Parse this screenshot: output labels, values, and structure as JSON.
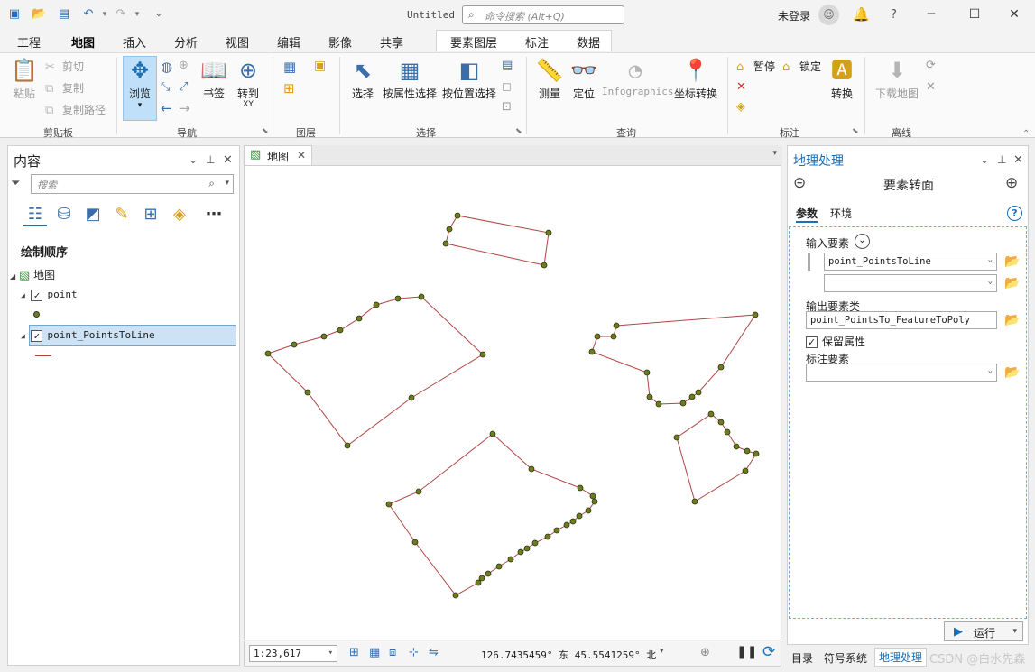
{
  "title_bar": {
    "doc_title": "Untitled",
    "search_placeholder": "命令搜索 (Alt+Q)",
    "signin_label": "未登录",
    "help_label": "?"
  },
  "ribbon_tabs": [
    "工程",
    "地图",
    "插入",
    "分析",
    "视图",
    "编辑",
    "影像",
    "共享"
  ],
  "ribbon_active_tab": "地图",
  "context_tabs": [
    "要素图层",
    "标注",
    "数据"
  ],
  "ribbon": {
    "clipboard": {
      "paste": "粘贴",
      "cut": "剪切",
      "copy": "复制",
      "copy_path": "复制路径",
      "label": "剪贴板"
    },
    "navigate": {
      "explore": "浏览",
      "bookmarks": "书签",
      "goto": "转到",
      "goto_sub": "XY",
      "label": "导航"
    },
    "layer": {
      "label": "图层"
    },
    "selection": {
      "select": "选择",
      "by_attr": "按属性选择",
      "by_loc": "按位置选择",
      "label": "选择"
    },
    "inquiry": {
      "measure": "测量",
      "locate": "定位",
      "infographics": "Infographics",
      "convert_coords": "坐标转换",
      "label": "查询"
    },
    "labeling": {
      "pause": "暂停",
      "lock": "锁定",
      "convert": "转换",
      "label": "标注"
    },
    "offline": {
      "download_map": "下载地图",
      "label": "离线"
    }
  },
  "contents": {
    "title": "内容",
    "search_placeholder": "搜索",
    "draw_order_label": "绘制顺序",
    "map_name": "地图",
    "layers": [
      {
        "name": "point",
        "checked": true
      },
      {
        "name": "point_PointsToLine",
        "checked": true,
        "selected": true
      }
    ]
  },
  "map_view": {
    "tab_label": "地图",
    "scale": "1:23,617",
    "coordinates": "126.7435459° 东 45.5541259° 北"
  },
  "geoprocessing": {
    "title": "地理处理",
    "tool_name": "要素转面",
    "tabs": [
      "参数",
      "环境"
    ],
    "input_label": "输入要素",
    "input_value": "point_PointsToLine",
    "input_value_2": "",
    "output_label": "输出要素类",
    "output_value": "point_PointsTo_FeatureToPoly",
    "keep_attr_label": "保留属性",
    "keep_attr_checked": true,
    "label_features_label": "标注要素",
    "label_features_value": "",
    "run_label": "运行"
  },
  "bottom_tabs": [
    "目录",
    "符号系统",
    "地理处理"
  ],
  "bottom_active_tab": "地理处理",
  "watermark": "CSDN @白水先森",
  "colors": {
    "accent": "#1c6fb5",
    "line_color": "#b04545",
    "point_fill": "#6b7d1f",
    "explore_bg": "#bfe0f8"
  }
}
